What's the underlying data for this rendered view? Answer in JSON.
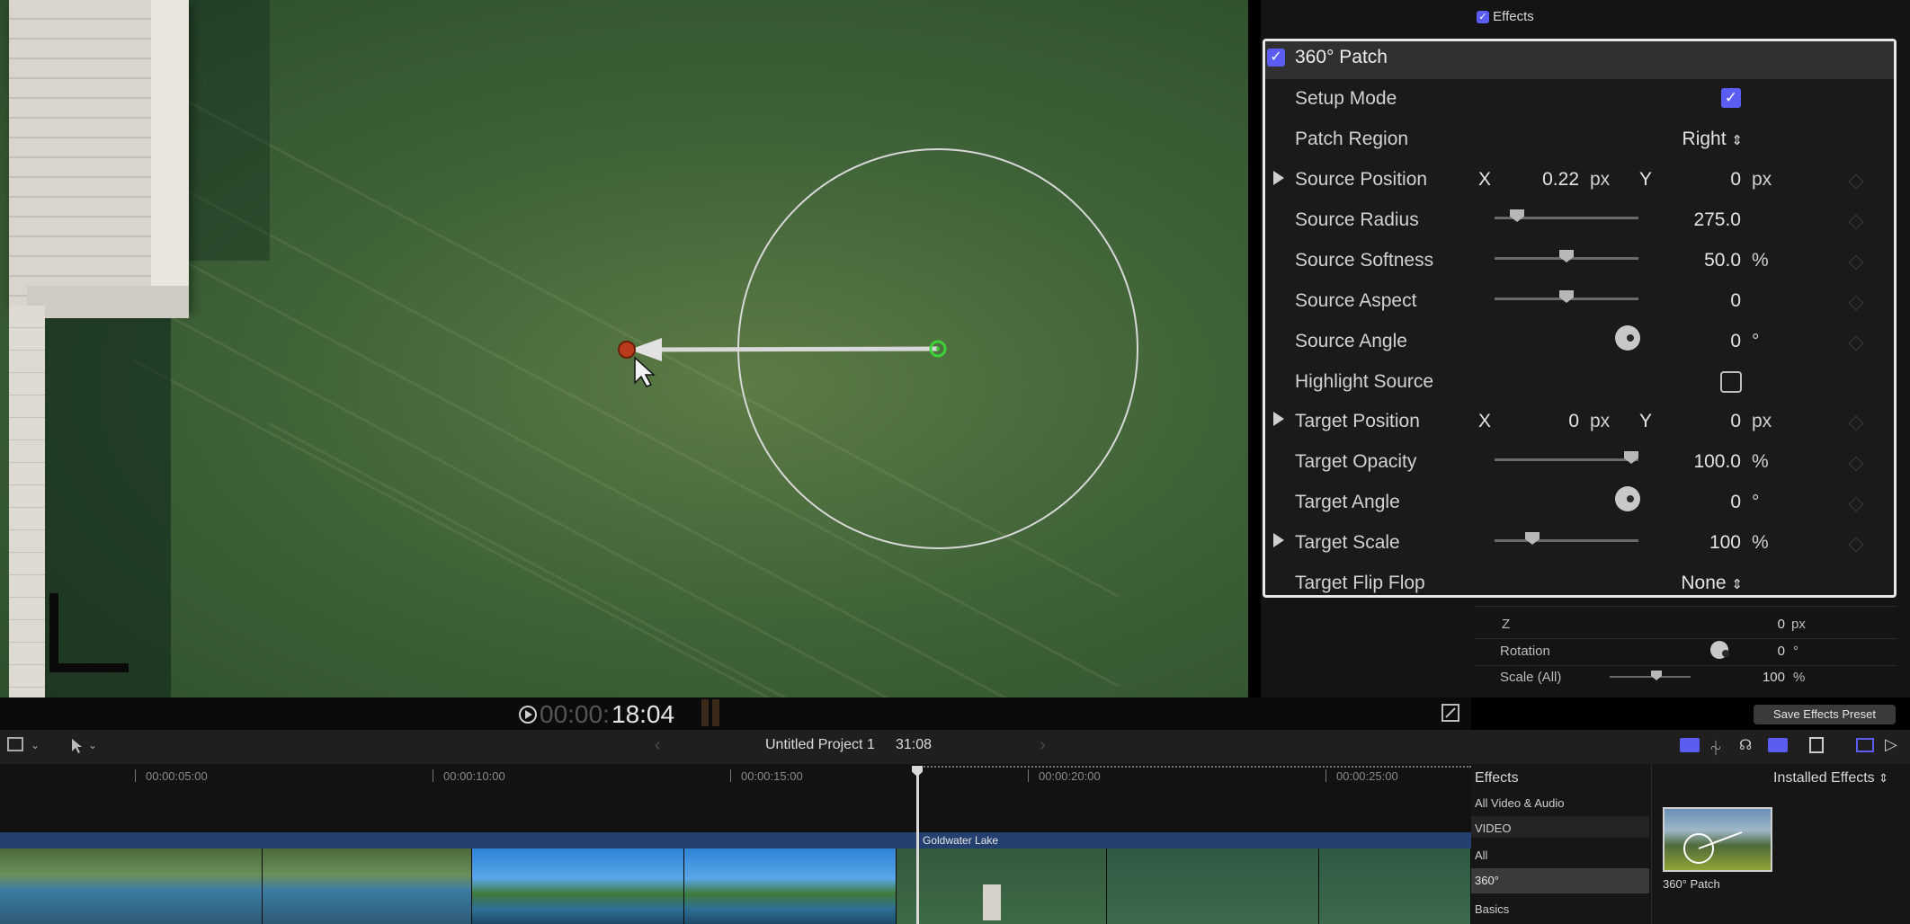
{
  "inspector": {
    "effects_header": "Effects",
    "patch": {
      "title": "360° Patch",
      "setup_mode": {
        "label": "Setup Mode",
        "checked": true
      },
      "patch_region": {
        "label": "Patch Region",
        "value": "Right"
      },
      "source_position": {
        "label": "Source Position",
        "x_label": "X",
        "x_value": "0.22",
        "x_unit": "px",
        "y_label": "Y",
        "y_value": "0",
        "y_unit": "px"
      },
      "source_radius": {
        "label": "Source Radius",
        "value": "275.0"
      },
      "source_softness": {
        "label": "Source Softness",
        "value": "50.0",
        "unit": "%"
      },
      "source_aspect": {
        "label": "Source Aspect",
        "value": "0"
      },
      "source_angle": {
        "label": "Source Angle",
        "value": "0",
        "unit": "°"
      },
      "highlight_source": {
        "label": "Highlight Source",
        "checked": false
      },
      "target_position": {
        "label": "Target Position",
        "x_label": "X",
        "x_value": "0",
        "x_unit": "px",
        "y_label": "Y",
        "y_value": "0",
        "y_unit": "px"
      },
      "target_opacity": {
        "label": "Target Opacity",
        "value": "100.0",
        "unit": "%"
      },
      "target_angle": {
        "label": "Target Angle",
        "value": "0",
        "unit": "°"
      },
      "target_scale": {
        "label": "Target Scale",
        "value": "100",
        "unit": "%"
      },
      "target_flip_flop": {
        "label": "Target Flip Flop",
        "value": "None"
      }
    },
    "transform": {
      "z": {
        "label": "Z",
        "value": "0",
        "unit": "px"
      },
      "rotation": {
        "label": "Rotation",
        "value": "0",
        "unit": "°"
      },
      "scale_all": {
        "label": "Scale (All)",
        "value": "100",
        "unit": "%"
      }
    },
    "save_preset_label": "Save Effects Preset"
  },
  "viewer": {
    "timecode_dim": "00:00:",
    "timecode": "18:04"
  },
  "toolbar": {
    "project_name": "Untitled Project 1",
    "duration": "31:08"
  },
  "ruler": {
    "marks": [
      "00:00:05:00",
      "00:00:10:00",
      "00:00:15:00",
      "00:00:20:00",
      "00:00:25:00"
    ]
  },
  "timeline": {
    "storyline_label": "Goldwater Lake"
  },
  "effects_browser": {
    "header": "Effects",
    "installed_label": "Installed Effects",
    "categories": [
      "All Video & Audio",
      "VIDEO",
      "All",
      "360°",
      "Basics"
    ],
    "selected_category": "360°",
    "thumbnail_label": "360° Patch"
  },
  "colors": {
    "accent": "#5b5cf2",
    "storyline": "#24406e",
    "viewer_water": "#3f6238"
  }
}
